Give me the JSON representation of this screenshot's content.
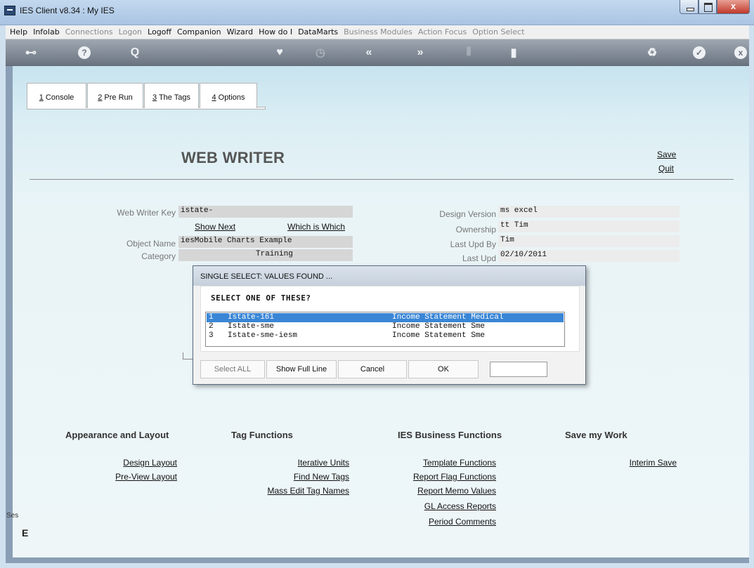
{
  "window": {
    "title": "IES Client v8.34 : My IES",
    "close_glyph": "x"
  },
  "menu": [
    {
      "label": "Help",
      "enabled": true
    },
    {
      "label": "Infolab",
      "enabled": true
    },
    {
      "label": "Connections",
      "enabled": false
    },
    {
      "label": "Logon",
      "enabled": false
    },
    {
      "label": "Logoff",
      "enabled": true
    },
    {
      "label": "Companion",
      "enabled": true
    },
    {
      "label": "Wizard",
      "enabled": true
    },
    {
      "label": "How do I",
      "enabled": true
    },
    {
      "label": "DataMarts",
      "enabled": true
    },
    {
      "label": "Business Modules",
      "enabled": false
    },
    {
      "label": "Action Focus",
      "enabled": false
    },
    {
      "label": "Option Select",
      "enabled": false
    }
  ],
  "toolbar": {
    "icons": [
      "key-icon",
      "help-icon",
      "search-icon",
      "heart-icon",
      "clock-icon",
      "back-icon",
      "forward-icon",
      "columns-icon",
      "page-icon",
      "recycle-icon",
      "check-icon",
      "close-icon"
    ],
    "glyphs": {
      "key": "⊷",
      "help": "?",
      "search": "Q",
      "heart": "♥",
      "clock": "◷",
      "back": "«",
      "forward": "»",
      "columns": "⫴",
      "page": "▮",
      "recycle": "♻",
      "check": "✓",
      "close": "x"
    }
  },
  "tabs": [
    {
      "num": "1",
      "label": " Console"
    },
    {
      "num": "2",
      "label": " Pre Run"
    },
    {
      "num": "3",
      "label": " The Tags"
    },
    {
      "num": "4",
      "label": " Options"
    }
  ],
  "header": {
    "title": "WEB WRITER",
    "save": "Save",
    "quit": "Quit"
  },
  "form": {
    "web_writer_key_label": "Web Writer Key",
    "web_writer_key": "istate-",
    "show_next": "Show Next",
    "which_is_which": "Which is Which",
    "object_name_label": "Object Name",
    "object_name": "iesMobile Charts Example",
    "category_label": "Category",
    "category": "Training",
    "design_version_label": "Design Version",
    "design_version": "ms excel",
    "ownership_label": "Ownership",
    "ownership": "tt Tim",
    "last_upd_by_label": "Last Upd By",
    "last_upd_by": "Tim",
    "last_upd_label": "Last Upd",
    "last_upd": "02/10/2011"
  },
  "dialog": {
    "title": "SINGLE SELECT: VALUES FOUND ...",
    "prompt": "SELECT ONE OF THESE?",
    "items": [
      {
        "num": "1",
        "key": "Istate-161",
        "desc": "Income Statement Medical",
        "selected": true
      },
      {
        "num": "2",
        "key": "Istate-sme",
        "desc": "Income Statement Sme",
        "selected": false
      },
      {
        "num": "3",
        "key": "Istate-sme-iesm",
        "desc": "Income Statement Sme",
        "selected": false
      }
    ],
    "buttons": {
      "select_all": "Select ALL",
      "show_full_line": "Show Full Line",
      "cancel": "Cancel",
      "ok": "OK"
    },
    "input_value": ""
  },
  "sections": {
    "appearance": {
      "title": "Appearance and Layout",
      "links": [
        "Design Layout",
        "Pre-View Layout"
      ]
    },
    "tags": {
      "title": "Tag Functions",
      "links": [
        "Iterative Units",
        "Find New Tags",
        "Mass Edit Tag Names"
      ]
    },
    "business": {
      "title": "IES Business Functions",
      "links": [
        "Template Functions",
        "Report Flag Functions",
        "Report Memo Values",
        "GL Access Reports",
        "Period Comments"
      ]
    },
    "save": {
      "title": "Save my Work",
      "links": [
        "Interim Save"
      ]
    }
  },
  "status": {
    "ses": "Ses",
    "e": "E"
  }
}
